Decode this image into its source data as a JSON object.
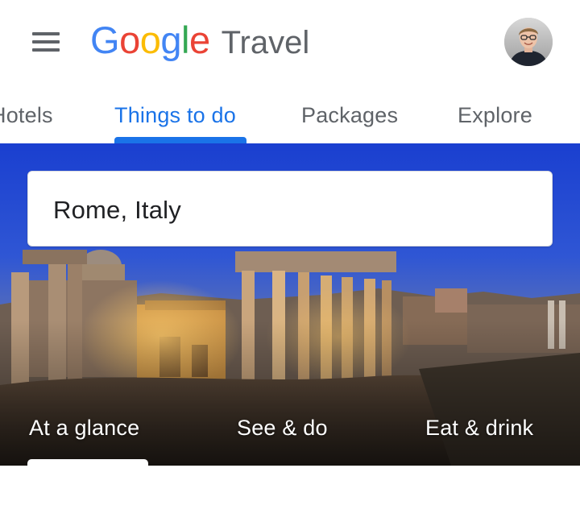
{
  "header": {
    "menu_icon": "hamburger-menu-icon",
    "logo_letters": [
      "G",
      "o",
      "o",
      "g",
      "l",
      "e"
    ],
    "product_name": "Travel",
    "avatar_icon": "user-avatar-photo"
  },
  "tabs": [
    {
      "label": "Hotels",
      "active": false
    },
    {
      "label": "Things to do",
      "active": true
    },
    {
      "label": "Packages",
      "active": false
    },
    {
      "label": "Explore",
      "active": false
    }
  ],
  "search": {
    "value": "Rome, Italy"
  },
  "hero_image": "rome-forum-ruins-at-dusk",
  "sections": [
    {
      "label": "At a glance",
      "active": true
    },
    {
      "label": "See & do",
      "active": false
    },
    {
      "label": "Eat & drink",
      "active": false
    }
  ],
  "colors": {
    "accent": "#1a73e8",
    "text_secondary": "#5f6368",
    "text_primary": "#202124"
  }
}
